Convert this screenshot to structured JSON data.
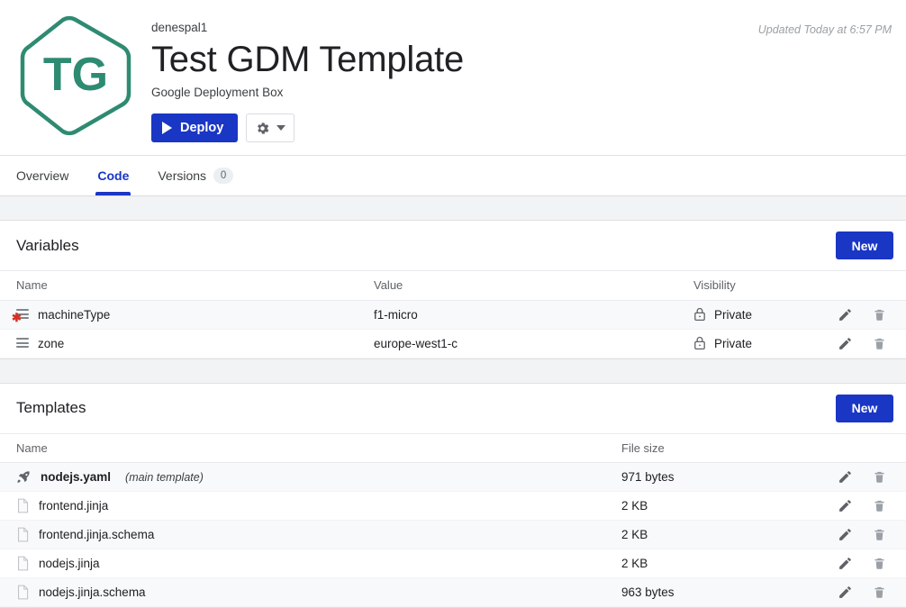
{
  "header": {
    "logo_initials": "TG",
    "logo_color": "#2e8b72",
    "owner": "denespal1",
    "title": "Test GDM Template",
    "subtitle": "Google Deployment Box",
    "updated": "Updated Today at 6:57 PM",
    "deploy_label": "Deploy",
    "settings_icon": "gear-icon",
    "play_icon": "play-icon",
    "caret_icon": "chevron-down-icon"
  },
  "tabs": [
    {
      "label": "Overview",
      "active": false,
      "badge": null
    },
    {
      "label": "Code",
      "active": true,
      "badge": null
    },
    {
      "label": "Versions",
      "active": false,
      "badge": "0"
    }
  ],
  "variables": {
    "title": "Variables",
    "new_label": "New",
    "columns": [
      "Name",
      "Value",
      "Visibility"
    ],
    "rows": [
      {
        "name": "machineType",
        "value": "f1-micro",
        "visibility": "Private",
        "required": true
      },
      {
        "name": "zone",
        "value": "europe-west1-c",
        "visibility": "Private",
        "required": false
      }
    ]
  },
  "templates": {
    "title": "Templates",
    "new_label": "New",
    "columns": [
      "Name",
      "File size"
    ],
    "rows": [
      {
        "name": "nodejs.yaml",
        "note": "(main template)",
        "size": "971 bytes",
        "icon": "rocket-icon",
        "main": true
      },
      {
        "name": "frontend.jinja",
        "note": "",
        "size": "2 KB",
        "icon": "file-icon",
        "main": false
      },
      {
        "name": "frontend.jinja.schema",
        "note": "",
        "size": "2 KB",
        "icon": "file-icon",
        "main": false
      },
      {
        "name": "nodejs.jinja",
        "note": "",
        "size": "2 KB",
        "icon": "file-icon",
        "main": false
      },
      {
        "name": "nodejs.jinja.schema",
        "note": "",
        "size": "963 bytes",
        "icon": "file-icon",
        "main": false
      }
    ]
  },
  "actions": {
    "edit_icon": "pencil-icon",
    "delete_icon": "trash-icon",
    "lock_icon": "lock-icon"
  },
  "colors": {
    "accent": "#1a36c4",
    "brand": "#2e8b72",
    "required": "#d93025"
  }
}
